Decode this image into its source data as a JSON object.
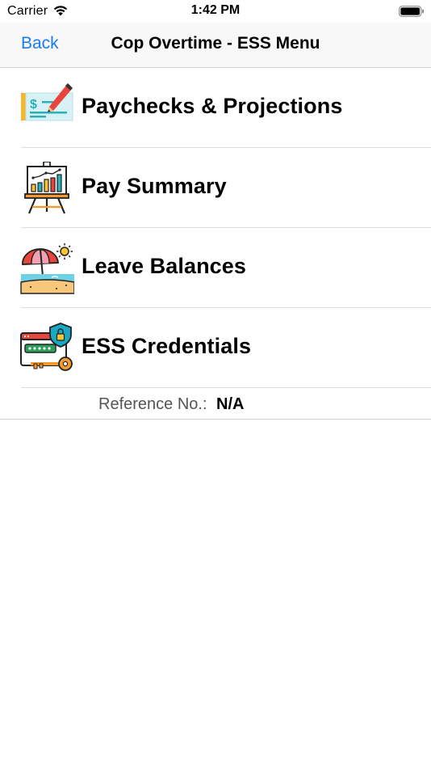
{
  "status_bar": {
    "carrier": "Carrier",
    "time": "1:42 PM",
    "wifi_icon": "wifi-icon",
    "battery_icon": "battery-full-icon"
  },
  "nav": {
    "back_label": "Back",
    "title": "Cop Overtime - ESS Menu",
    "accent_color": "#1a7cf5"
  },
  "menu": {
    "items": [
      {
        "label": "Paychecks & Projections",
        "icon": "check-pen-icon"
      },
      {
        "label": "Pay Summary",
        "icon": "chart-easel-icon"
      },
      {
        "label": "Leave Balances",
        "icon": "beach-umbrella-icon"
      },
      {
        "label": "ESS Credentials",
        "icon": "password-key-shield-icon"
      }
    ]
  },
  "reference": {
    "label": "Reference No.:",
    "value": "N/A"
  }
}
